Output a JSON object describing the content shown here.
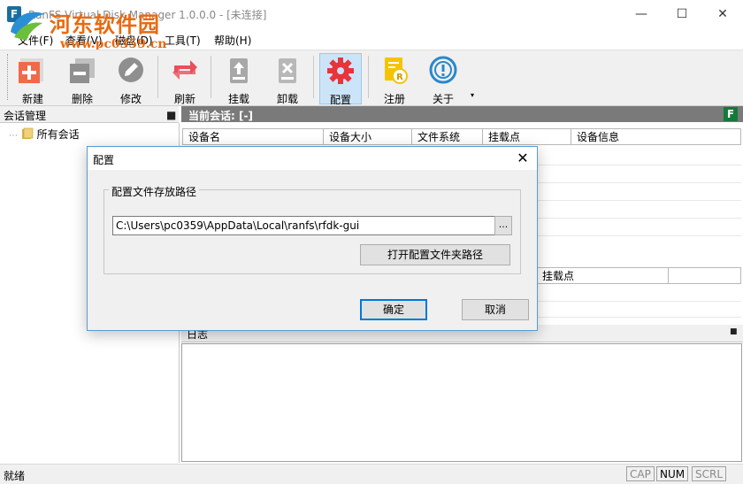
{
  "window": {
    "title": "RanFS Virtual Disk Manager 1.0.0.0 - [未连接]"
  },
  "watermark": {
    "name": "河东软件园",
    "url": "www.pc0359.cn"
  },
  "menu": {
    "items": [
      "文件(F)",
      "查看(V)",
      "磁盘(D)",
      "工具(T)",
      "帮助(H)"
    ]
  },
  "toolbar": {
    "buttons": [
      {
        "label": "新建",
        "icon": "new-icon"
      },
      {
        "label": "删除",
        "icon": "delete-icon"
      },
      {
        "label": "修改",
        "icon": "edit-icon"
      },
      {
        "label": "刷新",
        "icon": "refresh-icon"
      },
      {
        "label": "挂载",
        "icon": "mount-icon"
      },
      {
        "label": "卸载",
        "icon": "unmount-icon"
      },
      {
        "label": "配置",
        "icon": "gear-icon"
      },
      {
        "label": "注册",
        "icon": "register-icon"
      },
      {
        "label": "关于",
        "icon": "about-icon"
      }
    ],
    "overflow": "▾"
  },
  "left_panel": {
    "title": "会话管理",
    "tree_root": "所有会话"
  },
  "session_panel": {
    "title": "当前会话: [-]",
    "logo": "F",
    "columns": [
      "设备名",
      "设备大小",
      "文件系统",
      "挂载点",
      "设备信息"
    ],
    "lower_columns": [
      "挂载点"
    ]
  },
  "log_panel": {
    "title": "日志"
  },
  "status": {
    "text": "就绪",
    "indicators": [
      "CAP",
      "NUM",
      "SCRL"
    ]
  },
  "dialog": {
    "title": "配置",
    "group_label": "配置文件存放路径",
    "path_value": "C:\\Users\\pc0359\\AppData\\Local\\ranfs\\rfdk-gui",
    "browse_label": "...",
    "open_button": "打开配置文件夹路径",
    "ok_button": "确定",
    "cancel_button": "取消"
  },
  "colors": {
    "accent": "#0078d7",
    "session_header": "#7a7a7a",
    "watermark": "#e86a10"
  }
}
